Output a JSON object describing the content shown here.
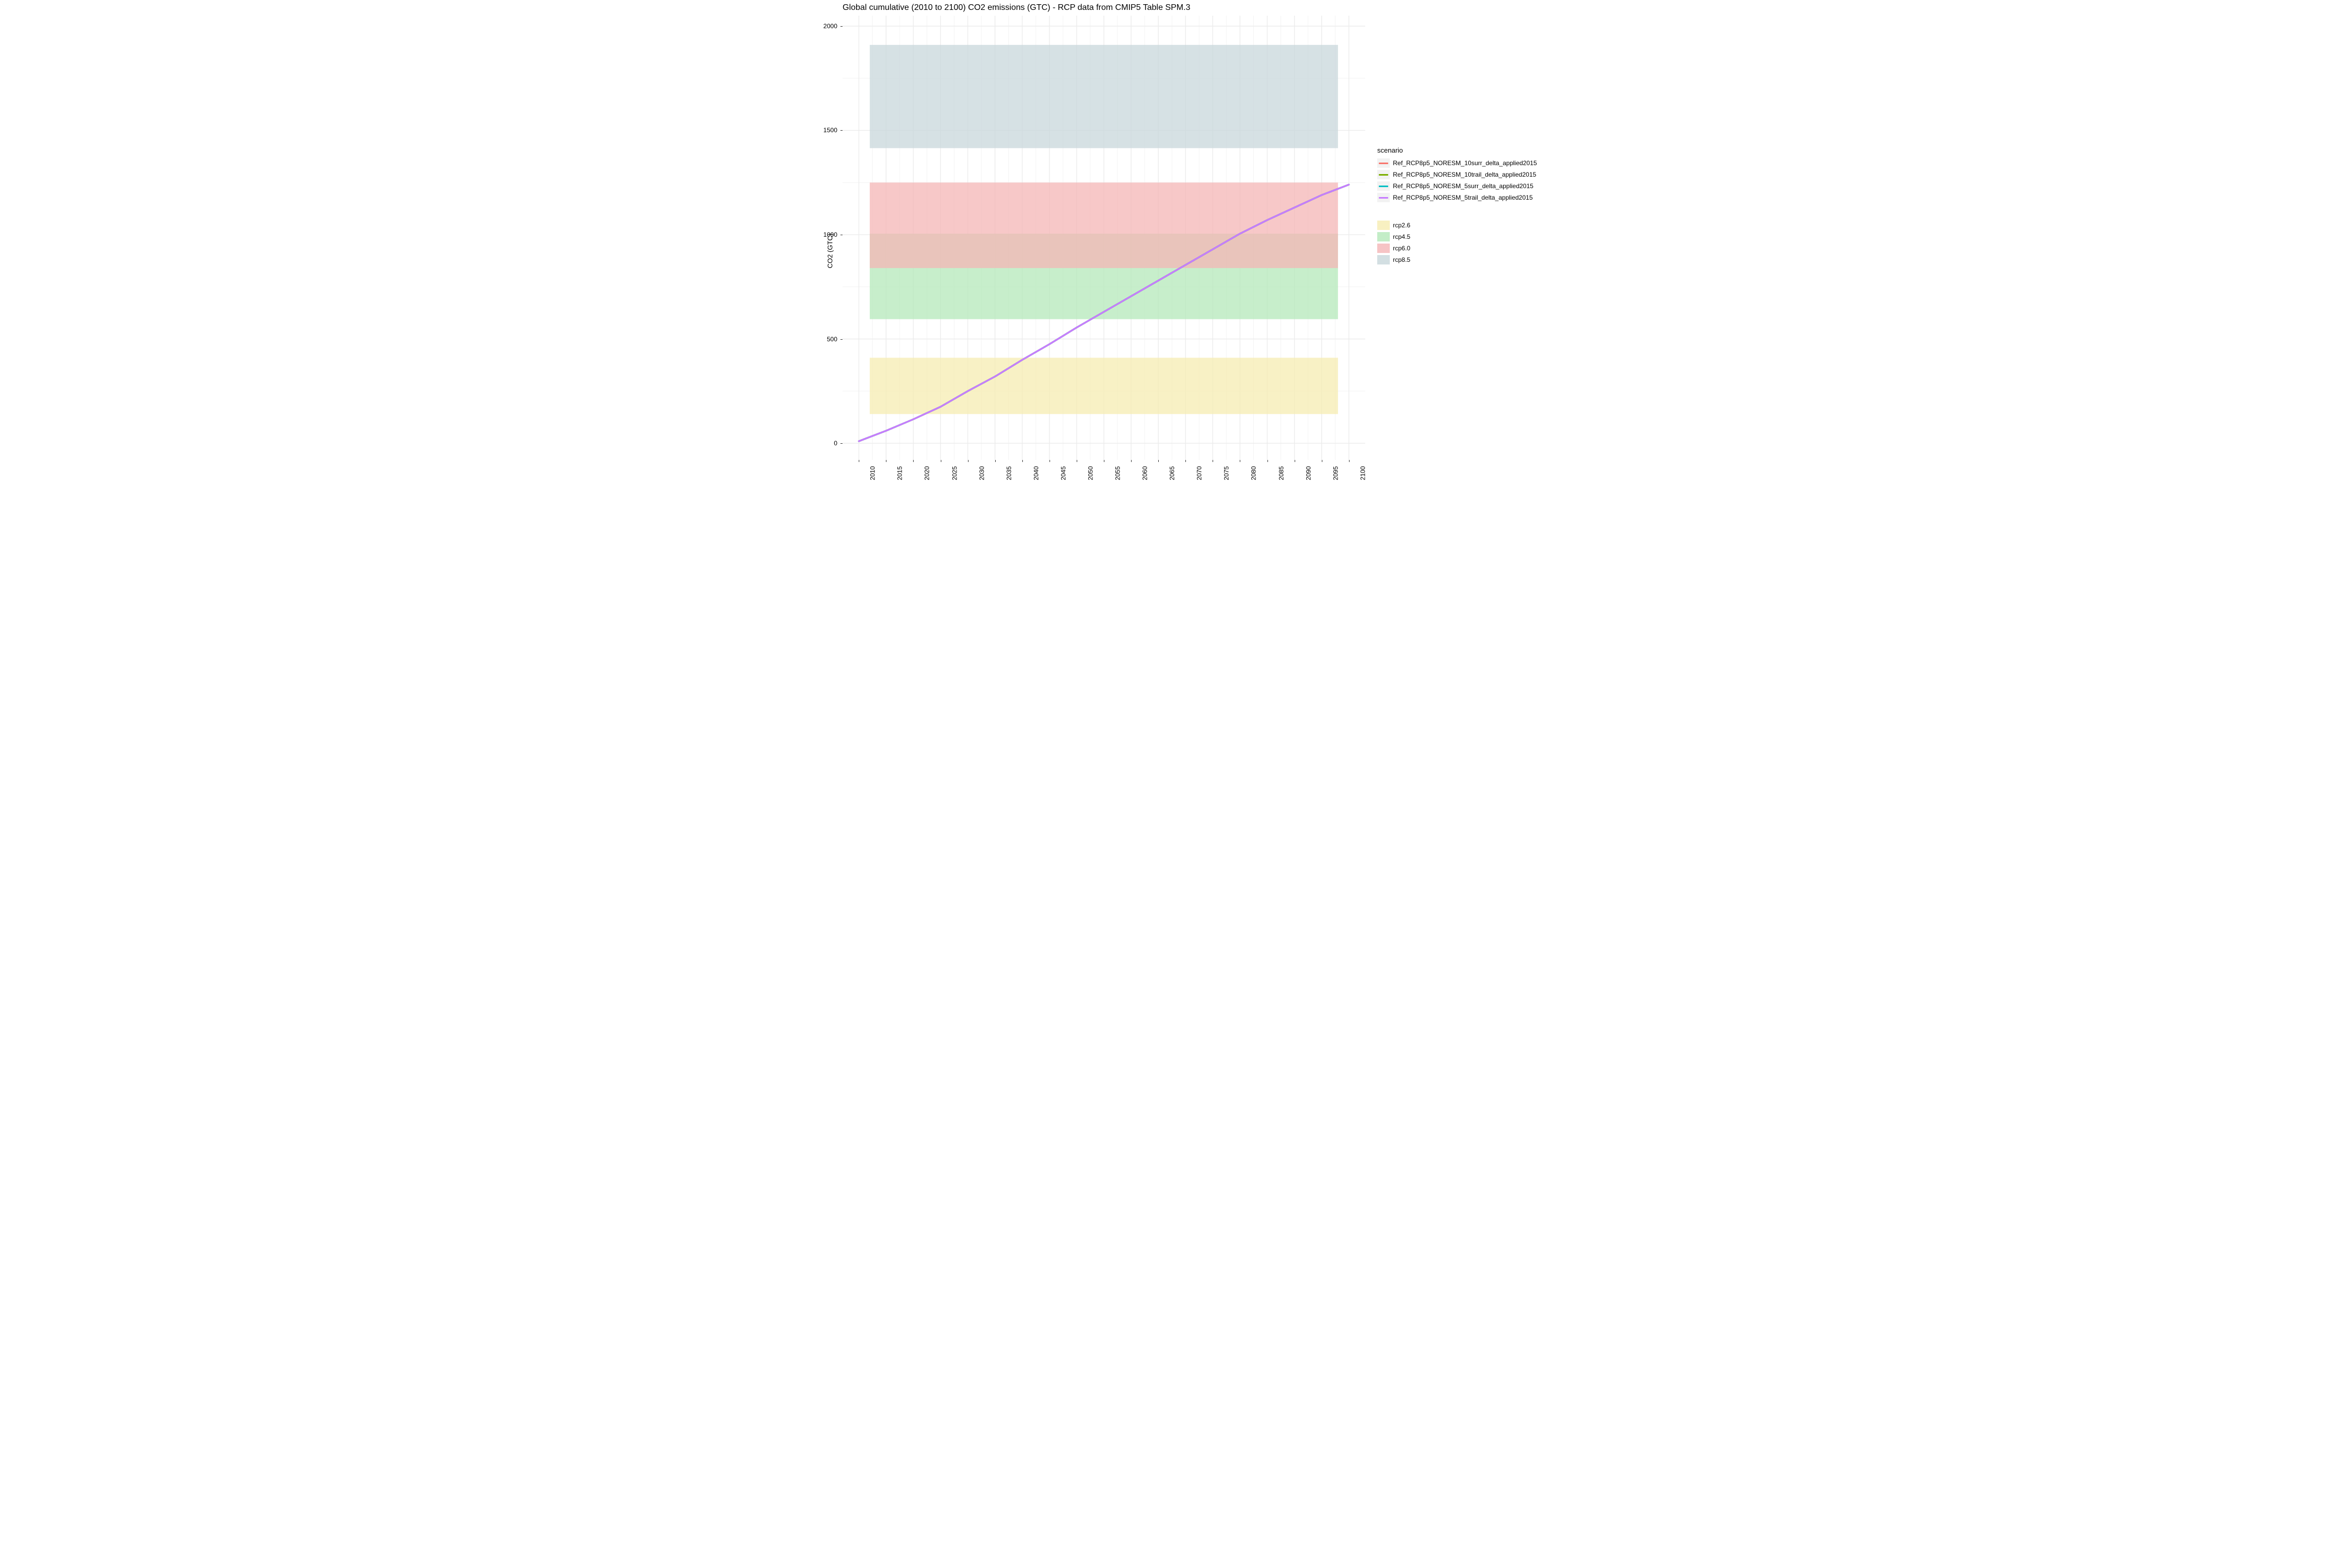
{
  "chart_data": {
    "type": "line",
    "title": "Global cumulative (2010 to 2100) CO2 emissions (GTC) - RCP data from CMIP5 Table SPM.3",
    "xlabel": "",
    "ylabel": "CO2 (GTC)",
    "x": [
      2010,
      2015,
      2020,
      2025,
      2030,
      2035,
      2040,
      2045,
      2050,
      2055,
      2060,
      2065,
      2070,
      2075,
      2080,
      2085,
      2090,
      2095,
      2100
    ],
    "x_ticks": [
      "2010",
      "2015",
      "2020",
      "2025",
      "2030",
      "2035",
      "2040",
      "2045",
      "2050",
      "2055",
      "2060",
      "2065",
      "2070",
      "2075",
      "2080",
      "2085",
      "2090",
      "2095",
      "2100"
    ],
    "y_ticks": [
      0,
      500,
      1000,
      1500,
      2000
    ],
    "xlim": [
      2007,
      2103
    ],
    "ylim": [
      -80,
      2050
    ],
    "series": [
      {
        "name": "Ref_RCP8p5_NORESM_10surr_delta_applied2015",
        "color": "#F8766D",
        "values": [
          10,
          60,
          115,
          175,
          250,
          320,
          400,
          475,
          555,
          630,
          705,
          780,
          855,
          930,
          1005,
          1070,
          1130,
          1190,
          1240
        ]
      },
      {
        "name": "Ref_RCP8p5_NORESM_10trail_delta_applied2015",
        "color": "#7CAE00",
        "values": [
          10,
          60,
          115,
          175,
          250,
          320,
          400,
          475,
          555,
          630,
          705,
          780,
          855,
          930,
          1005,
          1070,
          1130,
          1190,
          1240
        ]
      },
      {
        "name": "Ref_RCP8p5_NORESM_5surr_delta_applied2015",
        "color": "#00BFC4",
        "values": [
          10,
          60,
          115,
          175,
          250,
          320,
          400,
          475,
          555,
          630,
          705,
          780,
          855,
          930,
          1005,
          1070,
          1130,
          1190,
          1240
        ]
      },
      {
        "name": "Ref_RCP8p5_NORESM_5trail_delta_applied2015",
        "color": "#C77CFF",
        "values": [
          10,
          60,
          115,
          175,
          250,
          320,
          400,
          475,
          555,
          630,
          705,
          780,
          855,
          930,
          1005,
          1070,
          1130,
          1190,
          1240
        ]
      }
    ],
    "bands": [
      {
        "name": "rcp2.6",
        "color": "#F6ECB1",
        "x0": 2012,
        "x1": 2098,
        "y0": 140,
        "y1": 410
      },
      {
        "name": "rcp4.5",
        "color": "#B4E8B9",
        "x0": 2012,
        "x1": 2098,
        "y0": 595,
        "y1": 1005
      },
      {
        "name": "rcp6.0",
        "color": "#F4B5B6",
        "x0": 2012,
        "x1": 2098,
        "y0": 840,
        "y1": 1250
      },
      {
        "name": "rcp8.5",
        "color": "#C8D7DB",
        "x0": 2012,
        "x1": 2098,
        "y0": 1415,
        "y1": 1910
      }
    ],
    "legend_scenario_title": "scenario",
    "panel_bg": "#ffffff",
    "grid_major": "#ebebeb",
    "grid_minor": "#f4f4f4"
  }
}
